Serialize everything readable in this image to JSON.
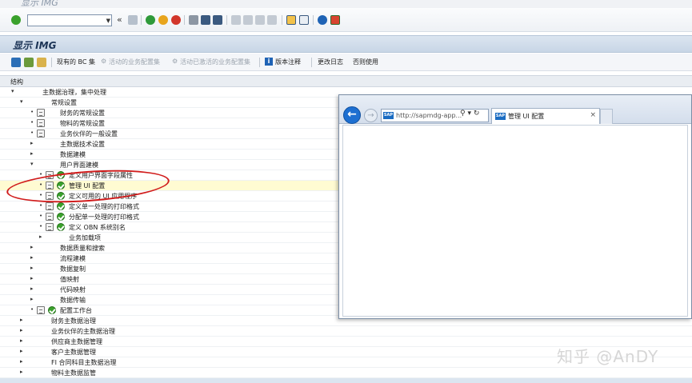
{
  "window": {
    "title": "显示 IMG"
  },
  "screen": {
    "title": "显示 IMG"
  },
  "toolbar": {
    "command_field_value": "",
    "collapse_glyph": "«"
  },
  "app_toolbar": {
    "buttons": [
      {
        "label": "现有的 BC 集",
        "enabled": true
      },
      {
        "label": "活动的业务配置集",
        "enabled": false
      },
      {
        "label": "活动已激活的业务配置集",
        "enabled": false
      },
      {
        "label": "版本注释",
        "enabled": true
      },
      {
        "label": "更改日志",
        "enabled": true
      },
      {
        "label": "否则使用",
        "enabled": true
      }
    ]
  },
  "tree": {
    "header": "结构",
    "rows": [
      {
        "label": "主数据治理，集中处理",
        "expanded": true
      },
      {
        "label": "常规设置",
        "expanded": true
      },
      {
        "label": "财务的常规设置"
      },
      {
        "label": "物料的常规设置"
      },
      {
        "label": "业务伙伴的一般设置"
      },
      {
        "label": "主数据技术设置"
      },
      {
        "label": "数据建模"
      },
      {
        "label": "用户界面建模",
        "expanded": true
      },
      {
        "label": "定义用户界面字段属性"
      },
      {
        "label": "管理 UI 配置"
      },
      {
        "label": "定义可用的 UI 应用程序"
      },
      {
        "label": "定义单一处理的打印格式"
      },
      {
        "label": "分配单一处理的打印格式"
      },
      {
        "label": "定义 OBN 系统别名"
      },
      {
        "label": "业务加载项"
      },
      {
        "label": "数据质量和搜索"
      },
      {
        "label": "流程建模"
      },
      {
        "label": "数据复制"
      },
      {
        "label": "值映射"
      },
      {
        "label": "代码映射"
      },
      {
        "label": "数据传输"
      },
      {
        "label": "配置工作台"
      },
      {
        "label": "财务主数据治理"
      },
      {
        "label": "业务伙伴的主数据治理"
      },
      {
        "label": "供应商主数据管理"
      },
      {
        "label": "客户主数据管理"
      },
      {
        "label": "FI 合同科目主数据治理"
      },
      {
        "label": "物料主数据监管"
      }
    ]
  },
  "browser": {
    "address": "http://sapmdg-app...",
    "address_tools": "⚲ ▾ ↻",
    "tab_title": "管理 UI 配置",
    "tab_close": "×",
    "logo_text": "SAP"
  },
  "watermark": "知乎 @AnDY",
  "colors": {
    "accent_blue": "#1d6fd1",
    "selection_yellow": "#fffbd2",
    "annotation_red": "#d11c1c",
    "check_green": "#3aa12c"
  }
}
